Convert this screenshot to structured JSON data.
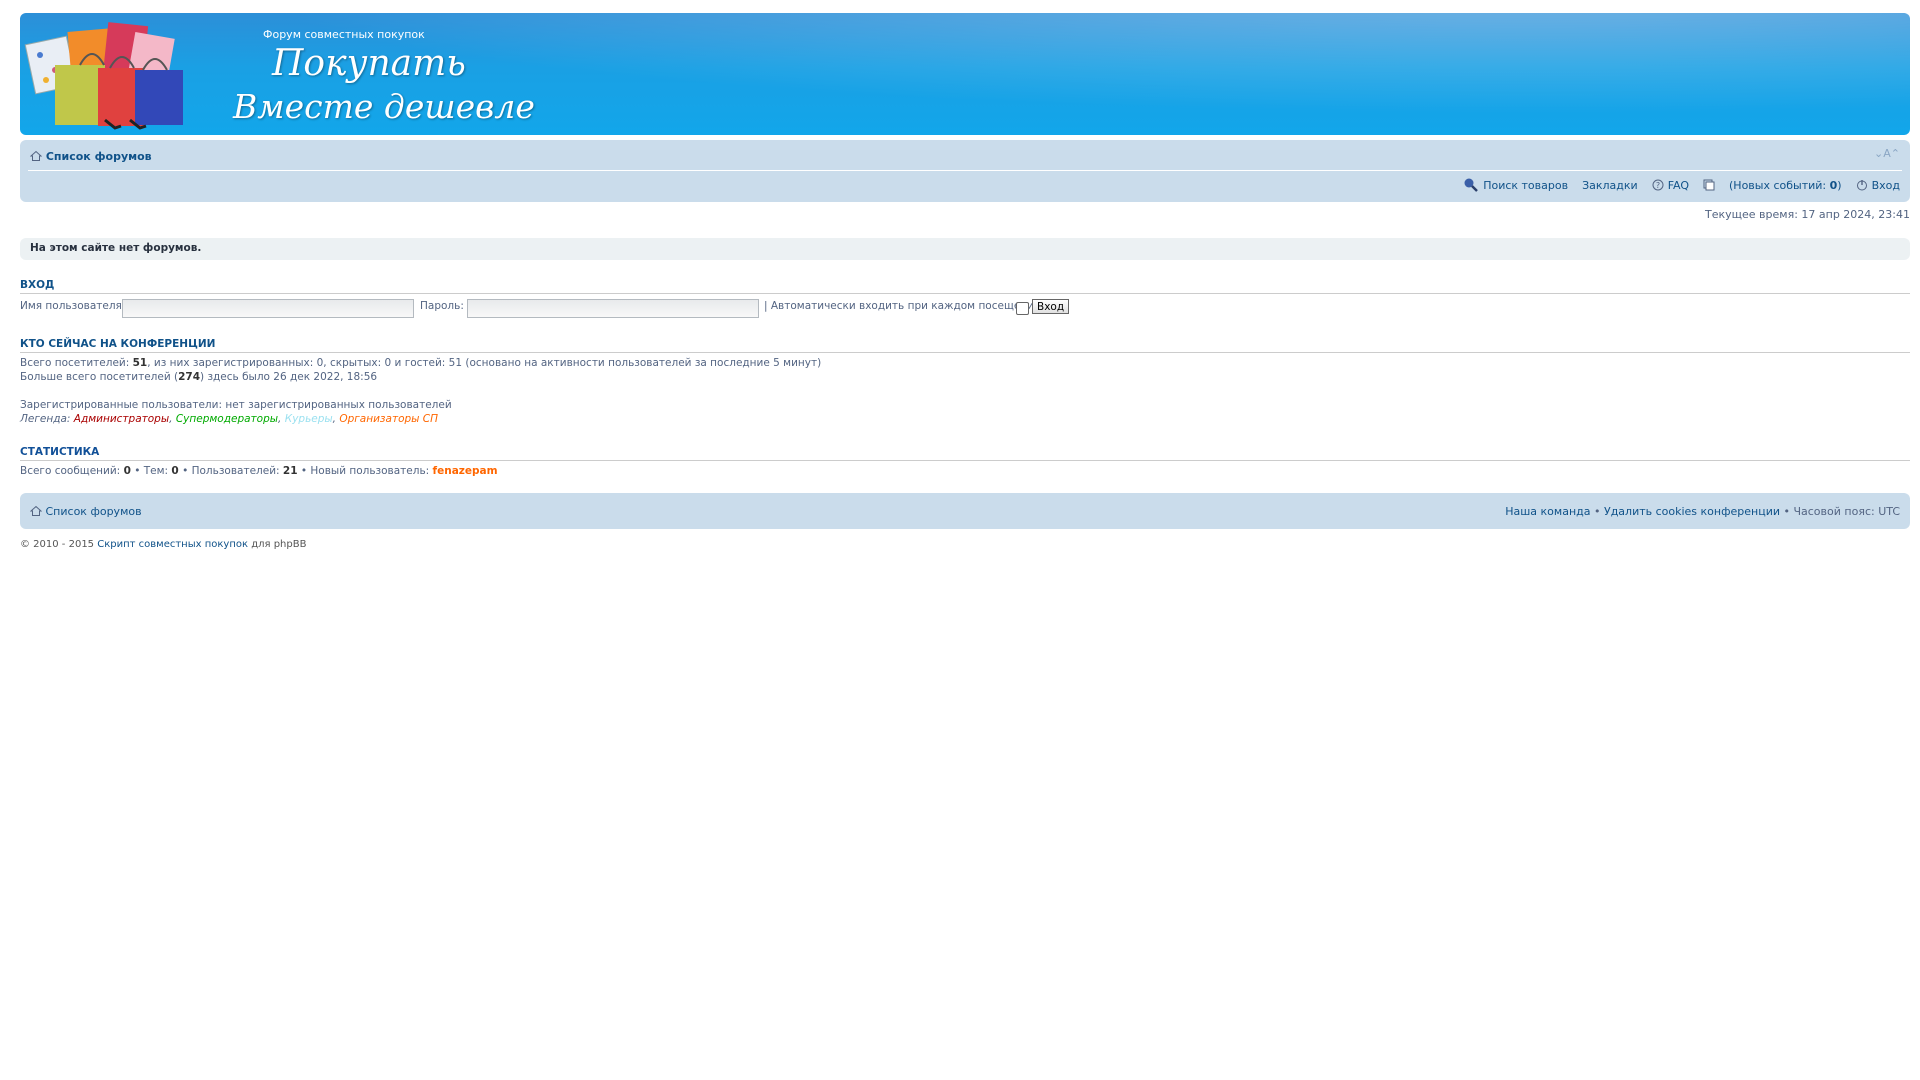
{
  "header": {
    "site_desc": "Форум совместных покупок",
    "title_line1": "Покупать",
    "title_line2": "Вместе дешевле"
  },
  "navbar": {
    "breadcrumb_index": "Список форумов",
    "fontsize_label": "⌄A⌃",
    "links": {
      "search_products": "Поиск товаров",
      "bookmarks": "Закладки",
      "faq": "FAQ",
      "new_events_prefix": "(Новых событий: ",
      "new_events_count": "0",
      "new_events_suffix": ")",
      "login": "Вход"
    }
  },
  "current_time": "Текущее время: 17 апр 2024, 23:41",
  "no_forums_message": "На этом сайте нет форумов.",
  "login_section": {
    "heading": "ВХОД",
    "username_label": "Имя пользователя:",
    "password_label": "Пароль:",
    "autologin_label": "| Автоматически входить при каждом посещении",
    "submit_label": "Вход"
  },
  "online_section": {
    "heading": "КТО СЕЙЧАС НА КОНФЕРЕНЦИИ",
    "total_prefix": "Всего посетителей: ",
    "total_count": "51",
    "total_suffix": ", из них зарегистрированных: 0, скрытых: 0 и гостей: 51 (основано на активности пользователей за последние 5 минут)",
    "record_prefix": "Больше всего посетителей (",
    "record_count": "274",
    "record_suffix": ") здесь было 26 дек 2022, 18:56",
    "registered_users": "Зарегистрированные пользователи: нет зарегистрированных пользователей",
    "legend_label": "Легенда: ",
    "legend": {
      "admins": "Администраторы",
      "supermods": "Супермодераторы",
      "couriers": "Курьеры",
      "organizers": "Организаторы СП"
    }
  },
  "stats_section": {
    "heading": "СТАТИСТИКА",
    "posts_label": "Всего сообщений: ",
    "posts_count": "0",
    "topics_label": " • Тем: ",
    "topics_count": "0",
    "users_label": " • Пользователей: ",
    "users_count": "21",
    "newest_label": " • Новый пользователь: ",
    "newest_user": "fenazepam"
  },
  "footer": {
    "breadcrumb_index": "Список форумов",
    "team": "Наша команда",
    "sep": " • ",
    "delete_cookies": "Удалить cookies конференции",
    "timezone": " • Часовой пояс: UTC",
    "copyright_prefix": "© 2010 - 2015 ",
    "copyright_link": "Скрипт совместных покупок",
    "copyright_suffix": " для phpBB"
  },
  "colors": {
    "header_blue": "#1aa0e4",
    "navbar_bg": "#cadceb",
    "link": "#105289",
    "admin": "#AA0000",
    "supermod": "#00AA00",
    "courier": "#9BE1F0",
    "organizer": "#FF6600"
  },
  "icons": [
    "home-icon",
    "search-icon",
    "faq-icon",
    "notifications-icon",
    "login-icon",
    "shopping-bags-logo"
  ]
}
